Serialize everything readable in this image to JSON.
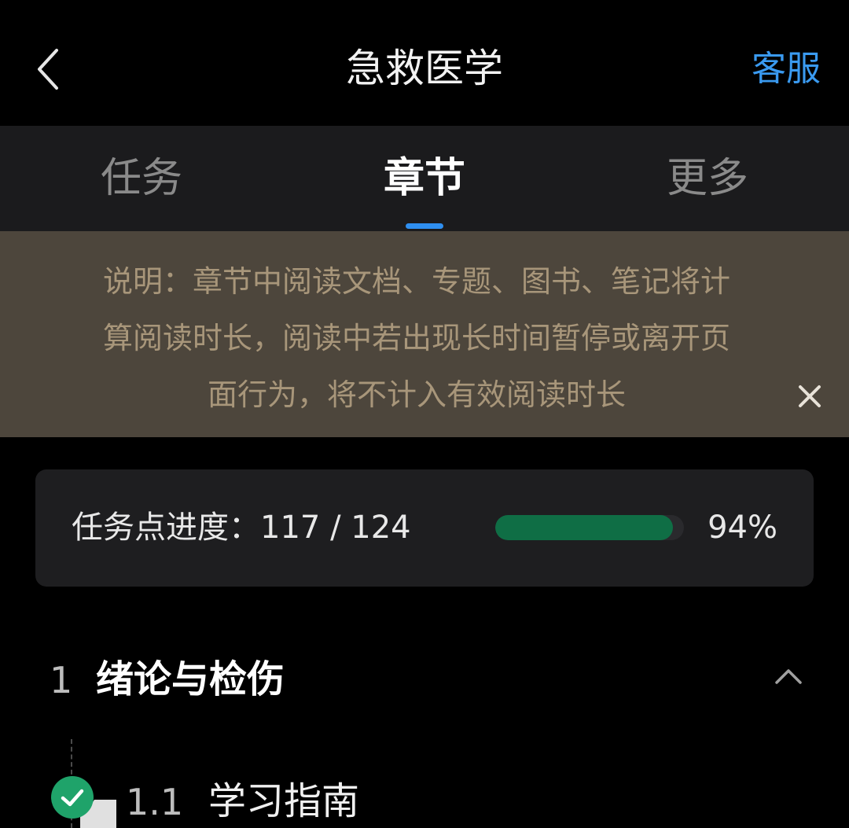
{
  "header": {
    "title": "急救医学",
    "service_label": "客服",
    "accent_color": "#3a9af0"
  },
  "tabs": [
    {
      "label": "任务",
      "active": false
    },
    {
      "label": "章节",
      "active": true
    },
    {
      "label": "更多",
      "active": false
    }
  ],
  "notice": {
    "line1": "说明：章节中阅读文档、专题、图书、笔记将计",
    "line2": "算阅读时长，阅读中若出现长时间暂停或离开页",
    "line3": "面行为，将不计入有效阅读时长"
  },
  "progress": {
    "label": "任务点进度：",
    "completed": 117,
    "total": 124,
    "count_text": "117 / 124",
    "percent_text": "94%",
    "fraction": 0.94,
    "bar_color": "#0f6e45"
  },
  "chapter": {
    "number": "1",
    "title": "绪论与检伤",
    "expanded": true,
    "sections": [
      {
        "number": "1.1",
        "title": "学习指南",
        "completed": true,
        "status_color": "#1fa36a"
      }
    ]
  },
  "icons": {
    "back": "chevron-left-icon",
    "close": "close-icon",
    "collapse": "chevron-up-icon",
    "complete": "check-circle-icon",
    "folder": "folder-icon"
  }
}
